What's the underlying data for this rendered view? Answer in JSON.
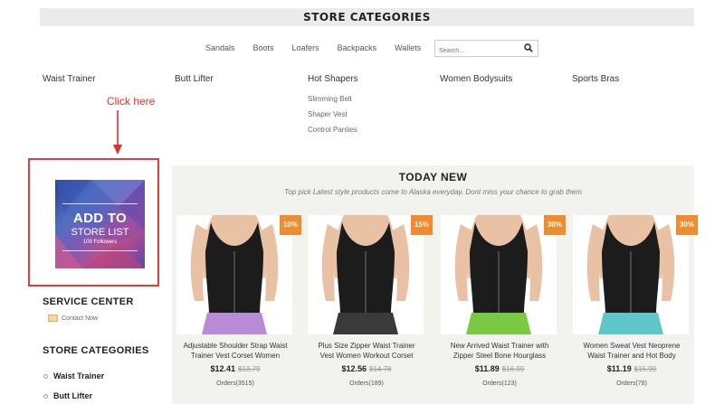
{
  "header": {
    "title": "STORE CATEGORIES"
  },
  "nav": {
    "links": [
      "Sandals",
      "Boots",
      "Loafers",
      "Backpacks",
      "Wallets"
    ],
    "search_placeholder": "Search..."
  },
  "categories": {
    "waist_trainer": "Waist Trainer",
    "butt_lifter": "Butt Lifter",
    "hot_shapers": "Hot Shapers",
    "hot_shapers_sub": [
      "Slimming Belt",
      "Shaper Vest",
      "Control Panties"
    ],
    "women_bodysuits": "Women Bodysuits",
    "sports_bras": "Sports Bras"
  },
  "annotation": {
    "click_here": "Click here"
  },
  "store_card": {
    "line1": "ADD TO",
    "line2": "STORE LIST",
    "followers": "109 Followers"
  },
  "sidebar": {
    "service_center": "SERVICE CENTER",
    "contact_now": "Contact Now",
    "store_categories": "STORE CATEGORIES",
    "items": [
      "Waist Trainer",
      "Butt Lifter"
    ]
  },
  "today_new": {
    "title": "TODAY NEW",
    "subtitle": "Top pick Latest style products come to Alaska everyday. Dont miss your chance to grab them",
    "products": [
      {
        "badge": "10%",
        "name_line1": "Adjustable Shoulder Strap Waist",
        "name_line2": "Trainer Vest Corset Women",
        "price": "$12.41",
        "old_price": "$13.79",
        "orders": "Orders(3515)",
        "shorts_color": "#b98ad6"
      },
      {
        "badge": "15%",
        "name_line1": "Plus Size Zipper Waist Trainer",
        "name_line2": "Vest Women Workout Corset",
        "price": "$12.56",
        "old_price": "$14.78",
        "orders": "Orders(189)",
        "shorts_color": "#3a3a3a"
      },
      {
        "badge": "30%",
        "name_line1": "New Arrived Waist Trainer with",
        "name_line2": "Zipper Steel Bone Hourglass",
        "price": "$11.89",
        "old_price": "$16.99",
        "orders": "Orders(123)",
        "shorts_color": "#7ac943"
      },
      {
        "badge": "30%",
        "name_line1": "Women Sweat Vest Neoprene",
        "name_line2": "Waist Trainer and Hot Body",
        "price": "$11.19",
        "old_price": "$15.99",
        "orders": "Orders(78)",
        "shorts_color": "#5fc6c9"
      }
    ]
  },
  "colors": {
    "accent_red": "#e23d3d",
    "badge_orange": "#f28b2d",
    "skin": "#e9c2a5",
    "garment": "#1c1c1c"
  }
}
